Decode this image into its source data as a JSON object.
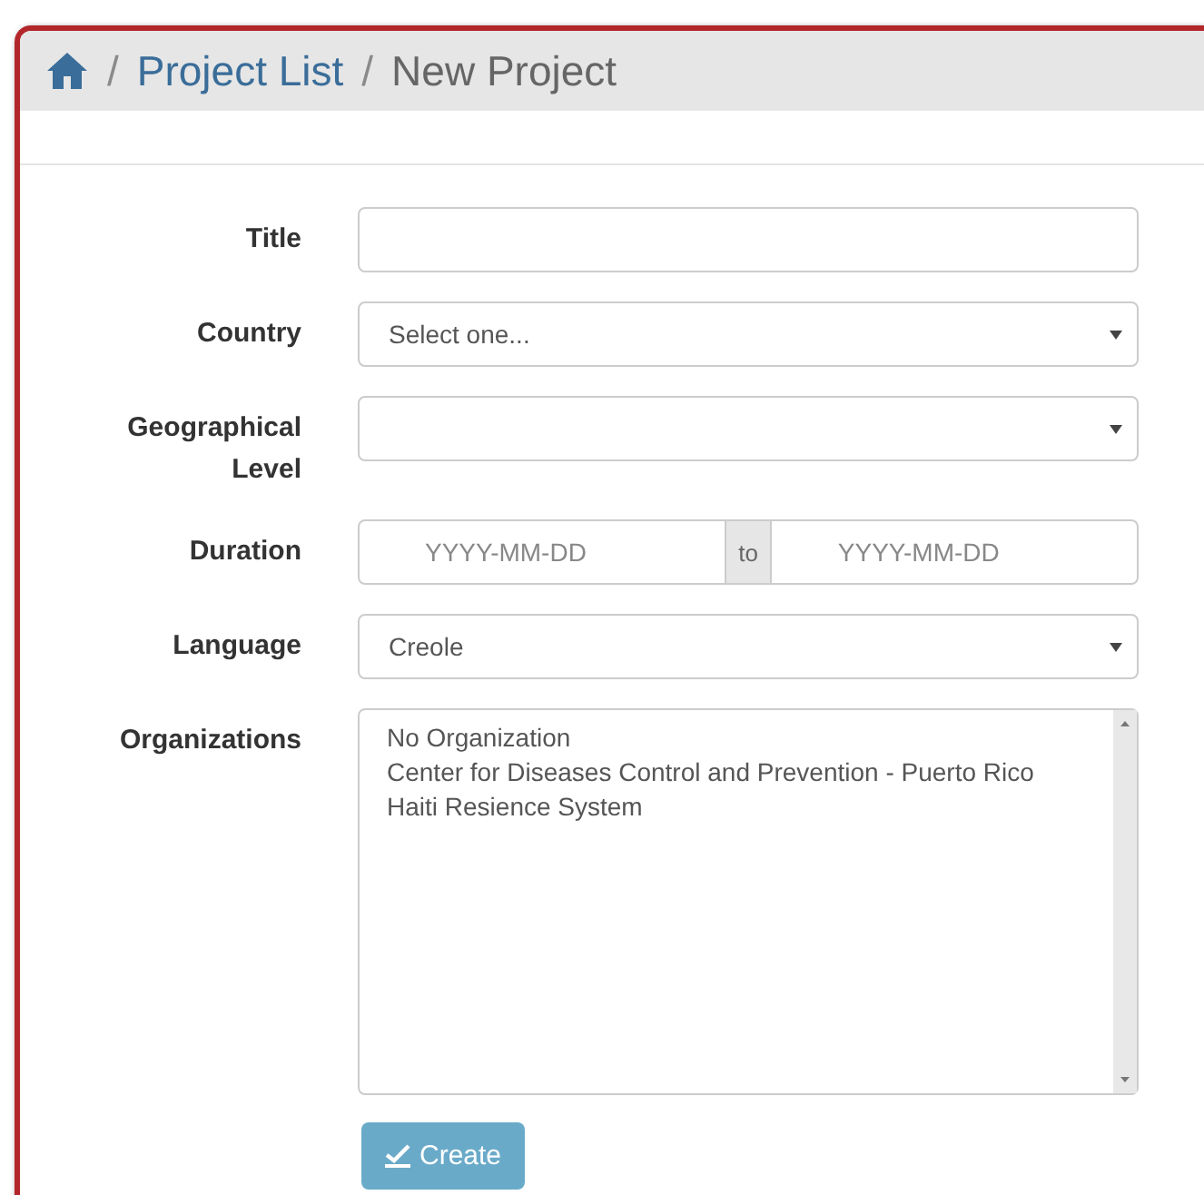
{
  "breadcrumb": {
    "items": [
      {
        "label": "Project List",
        "kind": "link"
      },
      {
        "label": "New Project",
        "kind": "current"
      }
    ],
    "separator": "/"
  },
  "form": {
    "fields": [
      {
        "label": "Title",
        "kind": "text"
      },
      {
        "label": "Country",
        "kind": "select",
        "value": "Select one..."
      },
      {
        "label": "Geographical Level",
        "kind": "select"
      },
      {
        "label": "Duration",
        "kind": "daterange",
        "from_placeholder": "YYYY-MM-DD",
        "joiner": "to",
        "to_placeholder": "YYYY-MM-DD"
      },
      {
        "label": "Language",
        "kind": "select",
        "value": "Creole"
      },
      {
        "label": "Organizations",
        "kind": "listbox",
        "options": [
          {
            "label": "No Organization",
            "selected": false
          },
          {
            "label": "Center for Diseases Control and Prevention - Puerto Rico",
            "selected": false
          },
          {
            "label": "Haiti Resience System",
            "selected": false
          }
        ]
      }
    ],
    "submit": {
      "label": "Create"
    }
  }
}
